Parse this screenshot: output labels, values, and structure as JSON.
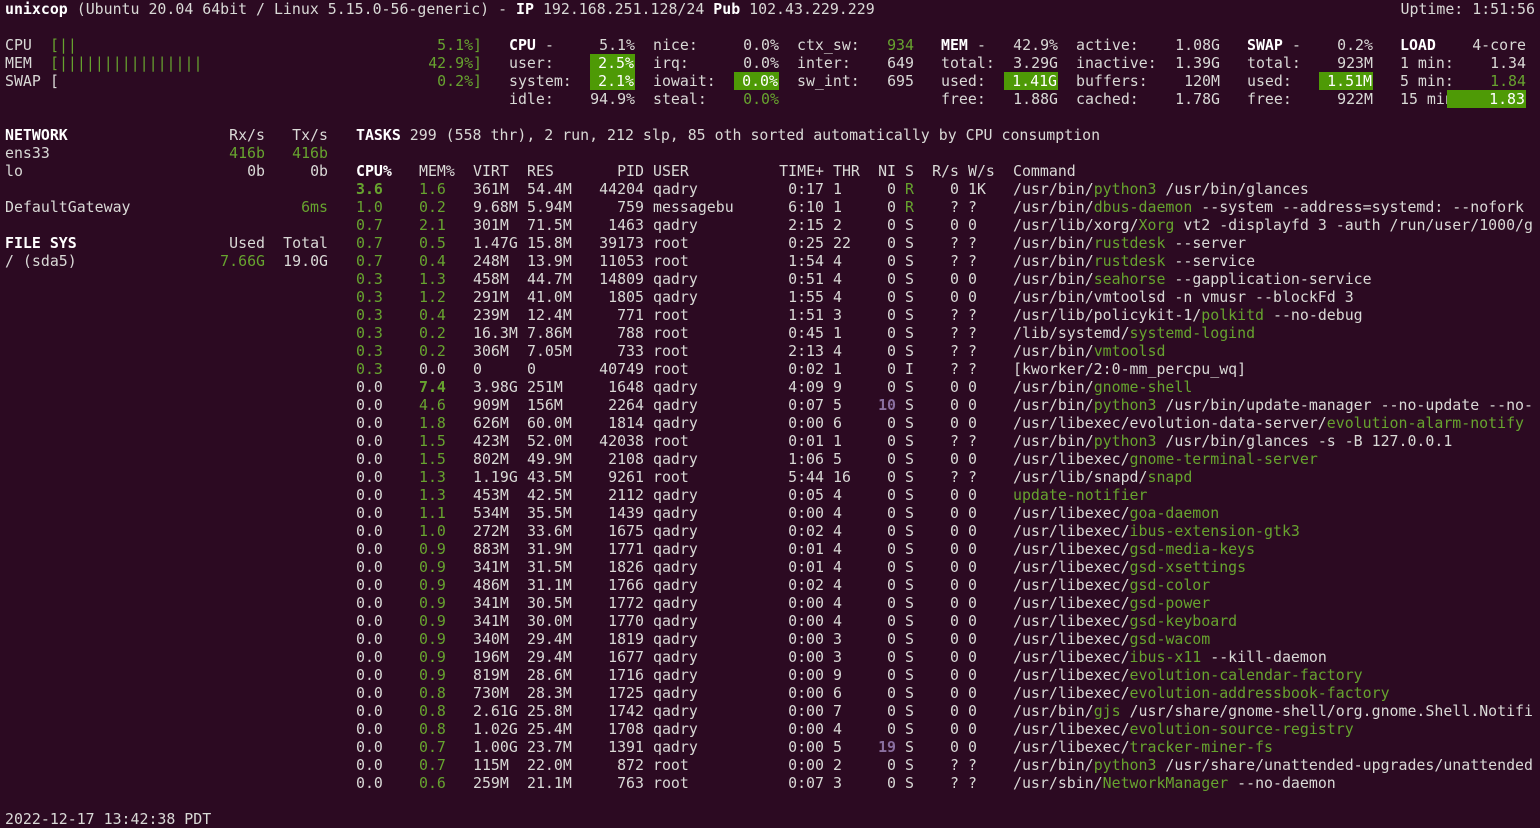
{
  "header": {
    "hostname": "unixcop",
    "os": "(Ubuntu 20.04 64bit / Linux 5.15.0-56-generic)",
    "ip_label": "IP",
    "ip": "192.168.251.128/24",
    "pub_label": "Pub",
    "pub": "102.43.229.229",
    "uptime": "Uptime: 1:51:56"
  },
  "quicklook": {
    "cpu": {
      "label": "CPU",
      "bar": "[||",
      "value": "5.1%]"
    },
    "mem": {
      "label": "MEM",
      "bar": "[||||||||||||||||",
      "value": "42.9%]"
    },
    "swap": {
      "label": "SWAP",
      "bar": "[",
      "value": "0.2%]"
    }
  },
  "cpu": {
    "title": "CPU",
    "dash": "-",
    "total": "5.1%",
    "user_label": "user:",
    "user": "2.5%",
    "system_label": "system:",
    "system": "2.1%",
    "idle_label": "idle:",
    "idle": "94.9%",
    "nice_label": "nice:",
    "nice": "0.0%",
    "irq_label": "irq:",
    "irq": "0.0%",
    "iowait_label": "iowait:",
    "iowait": "0.0%",
    "steal_label": "steal:",
    "steal": "0.0%",
    "ctx_sw_label": "ctx_sw:",
    "ctx_sw": "934",
    "inter_label": "inter:",
    "inter": "649",
    "sw_int_label": "sw_int:",
    "sw_int": "695"
  },
  "mem": {
    "title": "MEM",
    "dash": "-",
    "percent": "42.9%",
    "total_label": "total:",
    "total": "3.29G",
    "used_label": "used:",
    "used": "1.41G",
    "free_label": "free:",
    "free": "1.88G",
    "active_label": "active:",
    "active": "1.08G",
    "inactive_label": "inactive:",
    "inactive": "1.39G",
    "buffers_label": "buffers:",
    "buffers": "120M",
    "cached_label": "cached:",
    "cached": "1.78G"
  },
  "swap": {
    "title": "SWAP",
    "dash": "-",
    "percent": "0.2%",
    "total_label": "total:",
    "total": "923M",
    "used_label": "used:",
    "used": "1.51M",
    "free_label": "free:",
    "free": "922M"
  },
  "load": {
    "title": "LOAD",
    "cores": "4-core",
    "min1_label": "1 min:",
    "min1": "1.34",
    "min5_label": "5 min:",
    "min5": "1.84",
    "min15_label": "15 min:",
    "min15": "1.83"
  },
  "network": {
    "title": "NETWORK",
    "rx_label": "Rx/s",
    "tx_label": "Tx/s",
    "interfaces": [
      {
        "name": "ens33",
        "rx": "416b",
        "tx": "416b"
      },
      {
        "name": "lo",
        "rx": "0b",
        "tx": "0b"
      }
    ],
    "gateway_label": "DefaultGateway",
    "gateway": "6ms"
  },
  "filesys": {
    "title": "FILE SYS",
    "used_label": "Used",
    "total_label": "Total",
    "mounts": [
      {
        "name": "/ (sda5)",
        "used": "7.66G",
        "total": "19.0G"
      }
    ]
  },
  "tasks": {
    "label": "TASKS",
    "summary": "299 (558 thr), 2 run, 212 slp, 85 oth sorted automatically by CPU consumption"
  },
  "process_columns": [
    "CPU%",
    "MEM%",
    "VIRT",
    "RES",
    "PID",
    "USER",
    "TIME+",
    "THR",
    "NI",
    "S",
    "R/s",
    "W/s",
    "Command"
  ],
  "processes": [
    {
      "cpu": "3.6",
      "mem": "1.6",
      "virt": "361M",
      "res": "54.4M",
      "pid": "44204",
      "user": "qadry",
      "time": "0:17",
      "thr": "1",
      "ni": "0",
      "s": "R",
      "rs": "0",
      "ws": "1K",
      "cmd_pre": "/usr/bin/",
      "cmd_hl": "python3",
      "cmd_post": " /usr/bin/glances",
      "cpu_style": "bold"
    },
    {
      "cpu": "1.0",
      "mem": "0.2",
      "virt": "9.68M",
      "res": "5.94M",
      "pid": "759",
      "user": "messagebu",
      "time": "6:10",
      "thr": "1",
      "ni": "0",
      "s": "R",
      "rs": "?",
      "ws": "?",
      "cmd_pre": "/usr/bin/",
      "cmd_hl": "dbus-daemon",
      "cmd_post": " --system --address=systemd: --nofork",
      "cpu_style": "green"
    },
    {
      "cpu": "0.7",
      "mem": "2.1",
      "virt": "301M",
      "res": "71.5M",
      "pid": "1463",
      "user": "qadry",
      "time": "2:15",
      "thr": "2",
      "ni": "0",
      "s": "S",
      "rs": "0",
      "ws": "0",
      "cmd_pre": "/usr/lib/xorg/",
      "cmd_hl": "Xorg",
      "cmd_post": " vt2 -displayfd 3 -auth /run/user/1000/g",
      "cpu_style": "green"
    },
    {
      "cpu": "0.7",
      "mem": "0.5",
      "virt": "1.47G",
      "res": "15.8M",
      "pid": "39173",
      "user": "root",
      "time": "0:25",
      "thr": "22",
      "ni": "0",
      "s": "S",
      "rs": "?",
      "ws": "?",
      "cmd_pre": "/usr/bin/",
      "cmd_hl": "rustdesk",
      "cmd_post": " --server",
      "cpu_style": "green"
    },
    {
      "cpu": "0.7",
      "mem": "0.4",
      "virt": "248M",
      "res": "13.9M",
      "pid": "11053",
      "user": "root",
      "time": "1:54",
      "thr": "4",
      "ni": "0",
      "s": "S",
      "rs": "?",
      "ws": "?",
      "cmd_pre": "/usr/bin/",
      "cmd_hl": "rustdesk",
      "cmd_post": " --service",
      "cpu_style": "green"
    },
    {
      "cpu": "0.3",
      "mem": "1.3",
      "virt": "458M",
      "res": "44.7M",
      "pid": "14809",
      "user": "qadry",
      "time": "0:51",
      "thr": "4",
      "ni": "0",
      "s": "S",
      "rs": "0",
      "ws": "0",
      "cmd_pre": "/usr/bin/",
      "cmd_hl": "seahorse",
      "cmd_post": " --gapplication-service",
      "cpu_style": "green"
    },
    {
      "cpu": "0.3",
      "mem": "1.2",
      "virt": "291M",
      "res": "41.0M",
      "pid": "1805",
      "user": "qadry",
      "time": "1:55",
      "thr": "4",
      "ni": "0",
      "s": "S",
      "rs": "0",
      "ws": "0",
      "cmd_pre": "/usr/bin/vmtoolsd -n vmusr --blockFd 3",
      "cmd_hl": "",
      "cmd_post": "",
      "cpu_style": "green"
    },
    {
      "cpu": "0.3",
      "mem": "0.4",
      "virt": "239M",
      "res": "12.4M",
      "pid": "771",
      "user": "root",
      "time": "1:51",
      "thr": "3",
      "ni": "0",
      "s": "S",
      "rs": "?",
      "ws": "?",
      "cmd_pre": "/usr/lib/policykit-1/",
      "cmd_hl": "polkitd",
      "cmd_post": " --no-debug",
      "cpu_style": "green"
    },
    {
      "cpu": "0.3",
      "mem": "0.2",
      "virt": "16.3M",
      "res": "7.86M",
      "pid": "788",
      "user": "root",
      "time": "0:45",
      "thr": "1",
      "ni": "0",
      "s": "S",
      "rs": "?",
      "ws": "?",
      "cmd_pre": "/lib/systemd/",
      "cmd_hl": "systemd-logind",
      "cmd_post": "",
      "cpu_style": "green"
    },
    {
      "cpu": "0.3",
      "mem": "0.2",
      "virt": "306M",
      "res": "7.05M",
      "pid": "733",
      "user": "root",
      "time": "2:13",
      "thr": "4",
      "ni": "0",
      "s": "S",
      "rs": "?",
      "ws": "?",
      "cmd_pre": "/usr/bin/",
      "cmd_hl": "vmtoolsd",
      "cmd_post": "",
      "cpu_style": "green"
    },
    {
      "cpu": "0.3",
      "mem": "0.0",
      "virt": "0",
      "res": "0",
      "pid": "40749",
      "user": "root",
      "time": "0:02",
      "thr": "1",
      "ni": "0",
      "s": "I",
      "rs": "?",
      "ws": "?",
      "cmd_pre": "[kworker/2:0-mm_percpu_wq]",
      "cmd_hl": "",
      "cmd_post": "",
      "cpu_style": "green",
      "mem_style": "plain"
    },
    {
      "cpu": "0.0",
      "mem": "7.4",
      "virt": "3.98G",
      "res": "251M",
      "pid": "1648",
      "user": "qadry",
      "time": "4:09",
      "thr": "9",
      "ni": "0",
      "s": "S",
      "rs": "0",
      "ws": "0",
      "cmd_pre": "/usr/bin/",
      "cmd_hl": "gnome-shell",
      "cmd_post": "",
      "mem_style": "bold"
    },
    {
      "cpu": "0.0",
      "mem": "4.6",
      "virt": "909M",
      "res": "156M",
      "pid": "2264",
      "user": "qadry",
      "time": "0:07",
      "thr": "5",
      "ni": "10",
      "s": "S",
      "rs": "0",
      "ws": "0",
      "cmd_pre": "/usr/bin/",
      "cmd_hl": "python3",
      "cmd_post": " /usr/bin/update-manager --no-update --no-",
      "ni_style": "purple"
    },
    {
      "cpu": "0.0",
      "mem": "1.8",
      "virt": "626M",
      "res": "60.0M",
      "pid": "1814",
      "user": "qadry",
      "time": "0:00",
      "thr": "6",
      "ni": "0",
      "s": "S",
      "rs": "0",
      "ws": "0",
      "cmd_pre": "/usr/libexec/evolution-data-server/",
      "cmd_hl": "evolution-alarm-notify",
      "cmd_post": ""
    },
    {
      "cpu": "0.0",
      "mem": "1.5",
      "virt": "423M",
      "res": "52.0M",
      "pid": "42038",
      "user": "root",
      "time": "0:01",
      "thr": "1",
      "ni": "0",
      "s": "S",
      "rs": "?",
      "ws": "?",
      "cmd_pre": "/usr/bin/",
      "cmd_hl": "python3",
      "cmd_post": " /usr/bin/glances -s -B 127.0.0.1"
    },
    {
      "cpu": "0.0",
      "mem": "1.5",
      "virt": "802M",
      "res": "49.9M",
      "pid": "2108",
      "user": "qadry",
      "time": "1:06",
      "thr": "5",
      "ni": "0",
      "s": "S",
      "rs": "0",
      "ws": "0",
      "cmd_pre": "/usr/libexec/",
      "cmd_hl": "gnome-terminal-server",
      "cmd_post": ""
    },
    {
      "cpu": "0.0",
      "mem": "1.3",
      "virt": "1.19G",
      "res": "43.5M",
      "pid": "9261",
      "user": "root",
      "time": "5:44",
      "thr": "16",
      "ni": "0",
      "s": "S",
      "rs": "?",
      "ws": "?",
      "cmd_pre": "/usr/lib/snapd/",
      "cmd_hl": "snapd",
      "cmd_post": ""
    },
    {
      "cpu": "0.0",
      "mem": "1.3",
      "virt": "453M",
      "res": "42.5M",
      "pid": "2112",
      "user": "qadry",
      "time": "0:05",
      "thr": "4",
      "ni": "0",
      "s": "S",
      "rs": "0",
      "ws": "0",
      "cmd_pre": "",
      "cmd_hl": "update-notifier",
      "cmd_post": ""
    },
    {
      "cpu": "0.0",
      "mem": "1.1",
      "virt": "534M",
      "res": "35.5M",
      "pid": "1439",
      "user": "qadry",
      "time": "0:00",
      "thr": "4",
      "ni": "0",
      "s": "S",
      "rs": "0",
      "ws": "0",
      "cmd_pre": "/usr/libexec/",
      "cmd_hl": "goa-daemon",
      "cmd_post": ""
    },
    {
      "cpu": "0.0",
      "mem": "1.0",
      "virt": "272M",
      "res": "33.6M",
      "pid": "1675",
      "user": "qadry",
      "time": "0:02",
      "thr": "4",
      "ni": "0",
      "s": "S",
      "rs": "0",
      "ws": "0",
      "cmd_pre": "/usr/libexec/",
      "cmd_hl": "ibus-extension-gtk3",
      "cmd_post": ""
    },
    {
      "cpu": "0.0",
      "mem": "0.9",
      "virt": "883M",
      "res": "31.9M",
      "pid": "1771",
      "user": "qadry",
      "time": "0:01",
      "thr": "4",
      "ni": "0",
      "s": "S",
      "rs": "0",
      "ws": "0",
      "cmd_pre": "/usr/libexec/",
      "cmd_hl": "gsd-media-keys",
      "cmd_post": ""
    },
    {
      "cpu": "0.0",
      "mem": "0.9",
      "virt": "341M",
      "res": "31.5M",
      "pid": "1826",
      "user": "qadry",
      "time": "0:01",
      "thr": "4",
      "ni": "0",
      "s": "S",
      "rs": "0",
      "ws": "0",
      "cmd_pre": "/usr/libexec/",
      "cmd_hl": "gsd-xsettings",
      "cmd_post": ""
    },
    {
      "cpu": "0.0",
      "mem": "0.9",
      "virt": "486M",
      "res": "31.1M",
      "pid": "1766",
      "user": "qadry",
      "time": "0:02",
      "thr": "4",
      "ni": "0",
      "s": "S",
      "rs": "0",
      "ws": "0",
      "cmd_pre": "/usr/libexec/",
      "cmd_hl": "gsd-color",
      "cmd_post": ""
    },
    {
      "cpu": "0.0",
      "mem": "0.9",
      "virt": "341M",
      "res": "30.5M",
      "pid": "1772",
      "user": "qadry",
      "time": "0:00",
      "thr": "4",
      "ni": "0",
      "s": "S",
      "rs": "0",
      "ws": "0",
      "cmd_pre": "/usr/libexec/",
      "cmd_hl": "gsd-power",
      "cmd_post": ""
    },
    {
      "cpu": "0.0",
      "mem": "0.9",
      "virt": "341M",
      "res": "30.0M",
      "pid": "1770",
      "user": "qadry",
      "time": "0:00",
      "thr": "4",
      "ni": "0",
      "s": "S",
      "rs": "0",
      "ws": "0",
      "cmd_pre": "/usr/libexec/",
      "cmd_hl": "gsd-keyboard",
      "cmd_post": ""
    },
    {
      "cpu": "0.0",
      "mem": "0.9",
      "virt": "340M",
      "res": "29.4M",
      "pid": "1819",
      "user": "qadry",
      "time": "0:00",
      "thr": "3",
      "ni": "0",
      "s": "S",
      "rs": "0",
      "ws": "0",
      "cmd_pre": "/usr/libexec/",
      "cmd_hl": "gsd-wacom",
      "cmd_post": ""
    },
    {
      "cpu": "0.0",
      "mem": "0.9",
      "virt": "196M",
      "res": "29.4M",
      "pid": "1677",
      "user": "qadry",
      "time": "0:00",
      "thr": "3",
      "ni": "0",
      "s": "S",
      "rs": "0",
      "ws": "0",
      "cmd_pre": "/usr/libexec/",
      "cmd_hl": "ibus-x11",
      "cmd_post": " --kill-daemon"
    },
    {
      "cpu": "0.0",
      "mem": "0.9",
      "virt": "819M",
      "res": "28.6M",
      "pid": "1716",
      "user": "qadry",
      "time": "0:00",
      "thr": "9",
      "ni": "0",
      "s": "S",
      "rs": "0",
      "ws": "0",
      "cmd_pre": "/usr/libexec/",
      "cmd_hl": "evolution-calendar-factory",
      "cmd_post": ""
    },
    {
      "cpu": "0.0",
      "mem": "0.8",
      "virt": "730M",
      "res": "28.3M",
      "pid": "1725",
      "user": "qadry",
      "time": "0:00",
      "thr": "6",
      "ni": "0",
      "s": "S",
      "rs": "0",
      "ws": "0",
      "cmd_pre": "/usr/libexec/",
      "cmd_hl": "evolution-addressbook-factory",
      "cmd_post": ""
    },
    {
      "cpu": "0.0",
      "mem": "0.8",
      "virt": "2.61G",
      "res": "25.8M",
      "pid": "1742",
      "user": "qadry",
      "time": "0:00",
      "thr": "7",
      "ni": "0",
      "s": "S",
      "rs": "0",
      "ws": "0",
      "cmd_pre": "/usr/bin/",
      "cmd_hl": "gjs",
      "cmd_post": " /usr/share/gnome-shell/org.gnome.Shell.Notifi"
    },
    {
      "cpu": "0.0",
      "mem": "0.8",
      "virt": "1.02G",
      "res": "25.4M",
      "pid": "1708",
      "user": "qadry",
      "time": "0:00",
      "thr": "4",
      "ni": "0",
      "s": "S",
      "rs": "0",
      "ws": "0",
      "cmd_pre": "/usr/libexec/",
      "cmd_hl": "evolution-source-registry",
      "cmd_post": ""
    },
    {
      "cpu": "0.0",
      "mem": "0.7",
      "virt": "1.00G",
      "res": "23.7M",
      "pid": "1391",
      "user": "qadry",
      "time": "0:00",
      "thr": "5",
      "ni": "19",
      "s": "S",
      "rs": "0",
      "ws": "0",
      "cmd_pre": "/usr/libexec/",
      "cmd_hl": "tracker-miner-fs",
      "cmd_post": "",
      "ni_style": "purple"
    },
    {
      "cpu": "0.0",
      "mem": "0.7",
      "virt": "115M",
      "res": "22.0M",
      "pid": "872",
      "user": "root",
      "time": "0:00",
      "thr": "2",
      "ni": "0",
      "s": "S",
      "rs": "?",
      "ws": "?",
      "cmd_pre": "/usr/bin/",
      "cmd_hl": "python3",
      "cmd_post": " /usr/share/unattended-upgrades/unattended"
    },
    {
      "cpu": "0.0",
      "mem": "0.6",
      "virt": "259M",
      "res": "21.1M",
      "pid": "763",
      "user": "root",
      "time": "0:07",
      "thr": "3",
      "ni": "0",
      "s": "S",
      "rs": "?",
      "ws": "?",
      "cmd_pre": "/usr/sbin/",
      "cmd_hl": "NetworkManager",
      "cmd_post": " --no-daemon"
    }
  ],
  "footer": {
    "datetime": "2022-12-17 13:42:38 PDT"
  },
  "colors": {
    "background": "#2c0a22",
    "text": "#d9d9d6",
    "green": "#67a32f",
    "highlight_bg": "#4e9a06",
    "nice_purple": "#8a6fa0"
  }
}
